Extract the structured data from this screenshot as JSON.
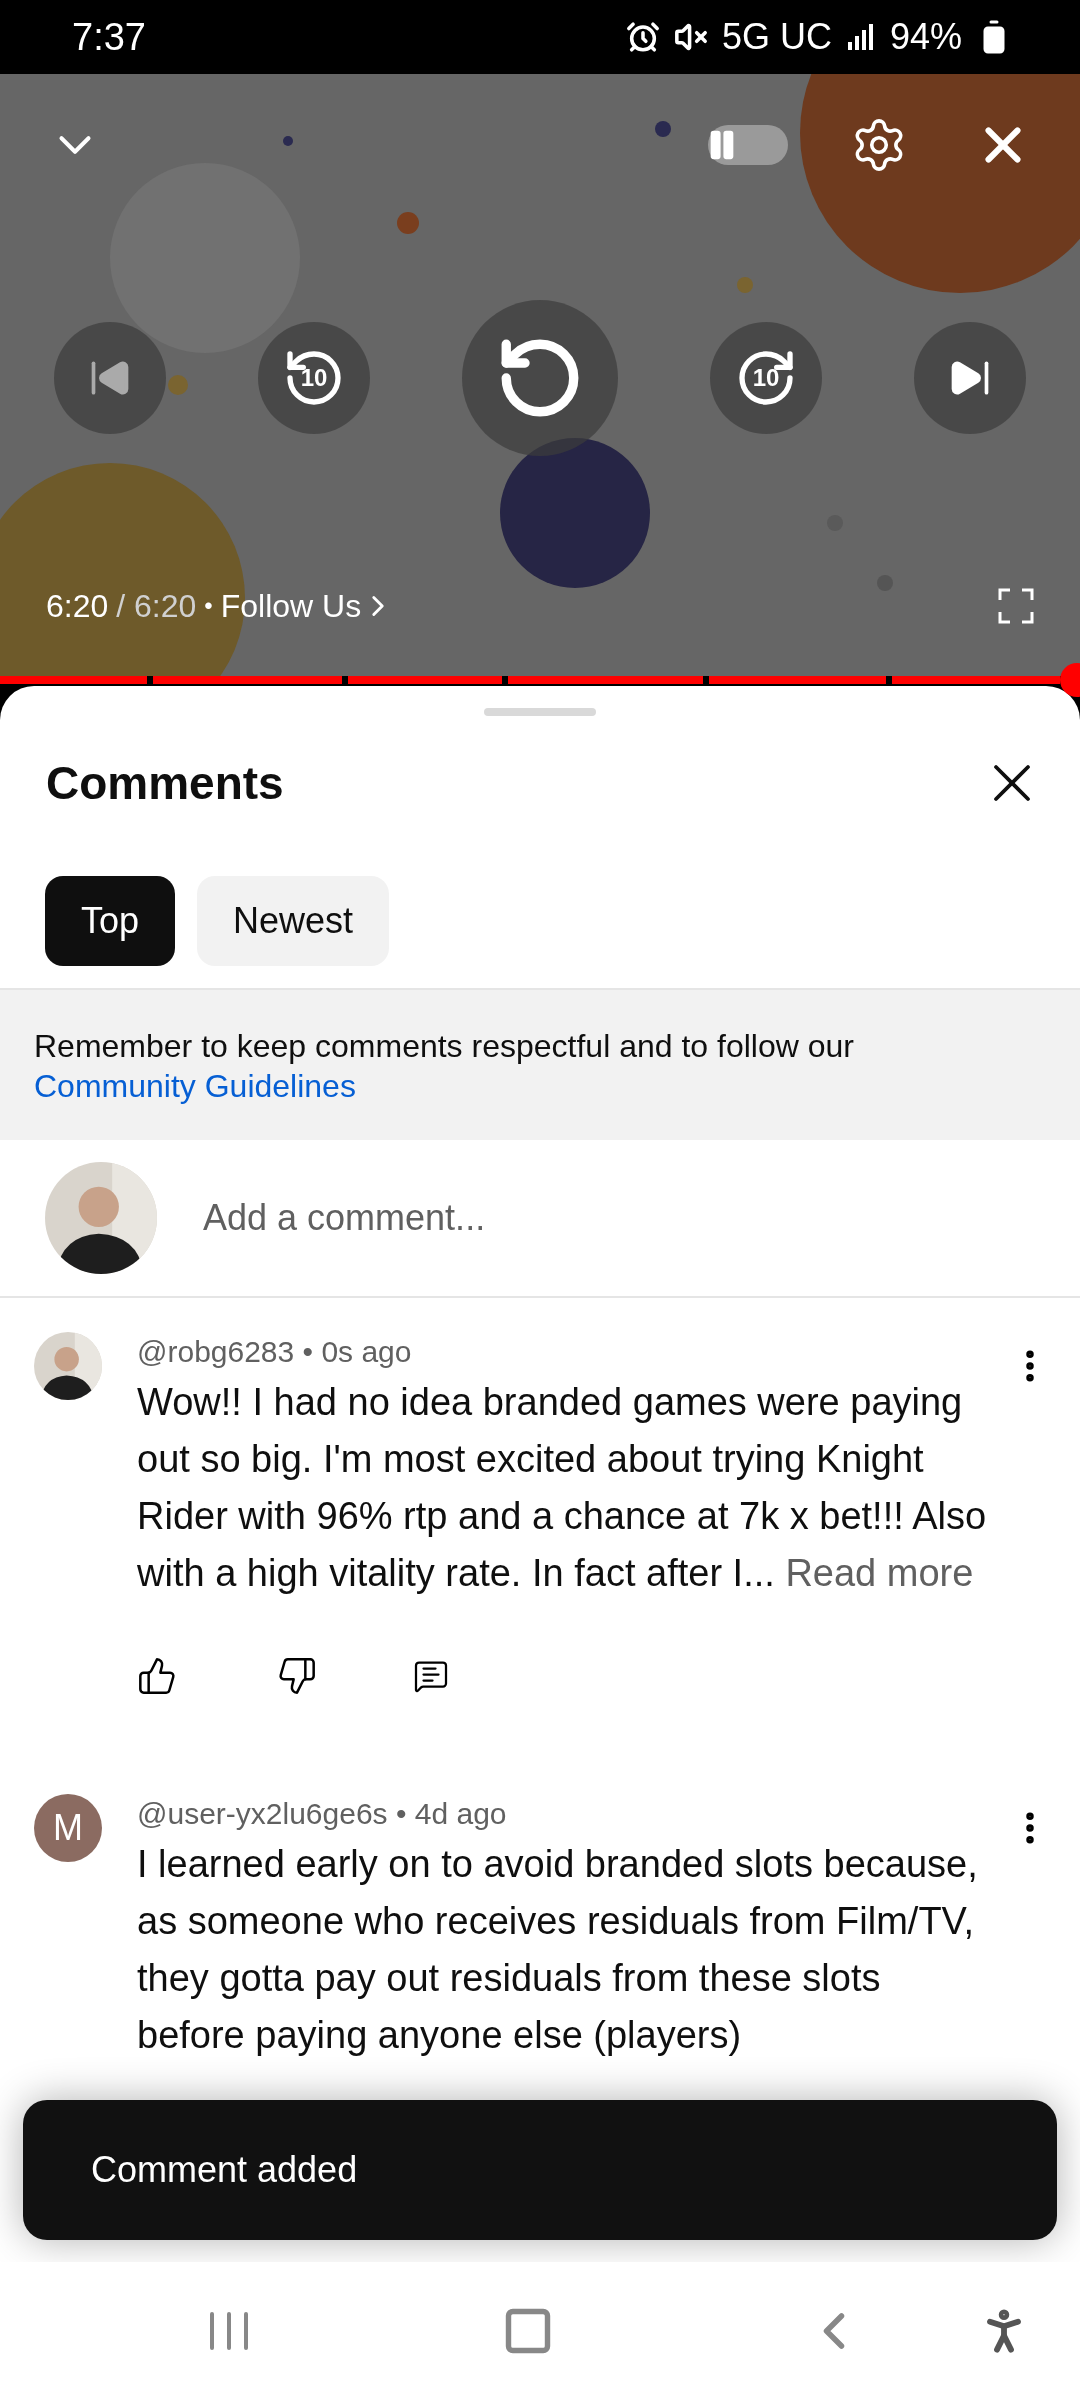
{
  "status_bar": {
    "time": "7:37",
    "network": "5G UC",
    "battery": "94%"
  },
  "player": {
    "autoplay_on": false,
    "skip_back": "10",
    "skip_forward": "10",
    "elapsed": "6:20",
    "duration": "/ 6:20",
    "separator": "•",
    "link": "Follow Us"
  },
  "comments_panel": {
    "title": "Comments",
    "tabs": [
      {
        "label": "Top",
        "selected": true
      },
      {
        "label": "Newest",
        "selected": false
      }
    ],
    "notice": "Remember to keep comments respectful and to follow our",
    "notice_link": "Community Guidelines",
    "compose": {
      "placeholder": "Add a comment..."
    },
    "comments": [
      {
        "meta": "@robg6283 • 0s ago",
        "text": "Wow!! I had no idea branded games were paying out so big. I'm most excited about trying Knight Rider with 96% rtp and a chance at 7k x bet!!! Also with a high vitality rate. In fact after I...",
        "more": "Read more"
      },
      {
        "avatar": {
          "kind": "letter",
          "letter": "M",
          "color": "#8b6b61"
        },
        "meta": "@user-yx2lu6ge6s • 4d ago",
        "text": "I learned early on to avoid branded slots because, as someone who receives residuals from Film/TV, they gotta pay out residuals from these slots before paying anyone else (players)"
      }
    ]
  },
  "toast": "Comment added"
}
